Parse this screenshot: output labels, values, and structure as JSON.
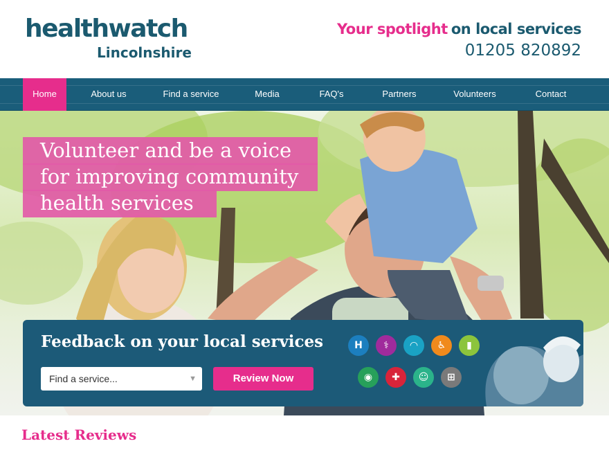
{
  "header": {
    "logo_main": "healthwatch",
    "logo_sub": "Lincolnshire",
    "tagline_highlight": "Your spotlight",
    "tagline_rest": "on local services",
    "phone": "01205 820892"
  },
  "nav": {
    "items": [
      {
        "label": "Home",
        "active": true
      },
      {
        "label": "About us"
      },
      {
        "label": "Find a service"
      },
      {
        "label": "Media"
      },
      {
        "label": "FAQ's"
      },
      {
        "label": "Partners"
      },
      {
        "label": "Volunteers"
      },
      {
        "label": "Contact"
      }
    ]
  },
  "hero": {
    "lines": [
      "Volunteer and be a voice",
      "for improving community",
      "health services"
    ]
  },
  "feedback": {
    "title": "Feedback on your local services",
    "select_value": "Find a service...",
    "button_label": "Review Now",
    "service_icons": [
      {
        "icon": "hospital-icon",
        "color": "#1c7fbf"
      },
      {
        "icon": "stethoscope-icon",
        "color": "#a02b9c"
      },
      {
        "icon": "tooth-icon",
        "color": "#1aa2c4"
      },
      {
        "icon": "walking-aid-icon",
        "color": "#f08a1c"
      },
      {
        "icon": "pill-icon",
        "color": "#8cc43c"
      },
      {
        "icon": "eye-icon",
        "color": "#27a05a"
      },
      {
        "icon": "ambulance-icon",
        "color": "#d8243a"
      },
      {
        "icon": "community-icon",
        "color": "#2bb38a"
      },
      {
        "icon": "first-aid-icon",
        "color": "#7a7a7a"
      }
    ]
  },
  "latest": {
    "title": "Latest Reviews"
  },
  "colors": {
    "brand_pink": "#e62d8c",
    "brand_blue": "#1b5a6f",
    "nav_blue": "#1a5d7a"
  }
}
